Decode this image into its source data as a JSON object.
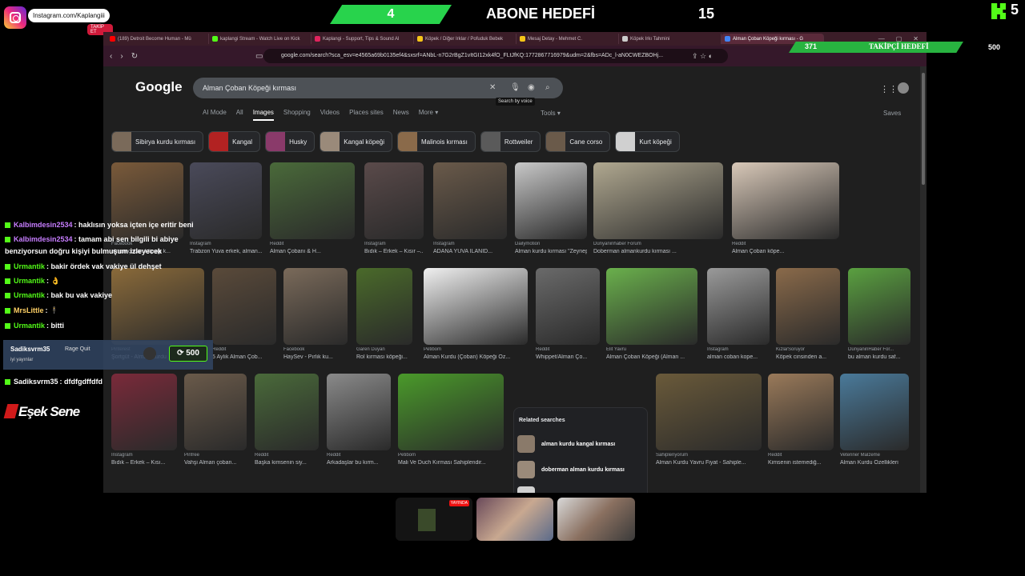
{
  "overlay": {
    "instagram_handle": "Instagram.com/Kaplangiii",
    "instagram_follow": "TAKİP ET",
    "sub_goal_current": "4",
    "sub_goal_title": "ABONE HEDEFİ",
    "sub_goal_target": "15",
    "kick_viewers": "5",
    "follower_current": "371",
    "follower_title": "TAKİPÇİ HEDEFİ",
    "follower_target": "500",
    "logo_text": "Eşek Sene",
    "live_badge": "YAYINDA"
  },
  "browser": {
    "tabs": [
      {
        "label": "(189) Detroit Become Human - Mü",
        "color": "#ff0000"
      },
      {
        "label": "kaplangi Stream - Watch Live on Kick",
        "color": "#53fc18"
      },
      {
        "label": "Kaplangi - Support, Tips & Sound Al",
        "color": "#e0245e"
      },
      {
        "label": "Köpek / Diğer Irklar / Pofuduk Bebek",
        "color": "#f5c518"
      },
      {
        "label": "Mesaj Detay - Mehmet C.",
        "color": "#f5c518"
      },
      {
        "label": "Köpek Irkı Tahmini",
        "color": "#cccccc"
      },
      {
        "label": "Alman Çoban Köpeği kırması - G",
        "color": "#4285f4"
      }
    ],
    "url": "google.com/search?sca_esv=e4565a69b0135ef4&sxsrf=ANbL-n7G2rBgZ1vItGI12xk4fO_FLtJfKQ:1772867716979&udm=2&fbs=ADc_l-aN0CWEZBOHj..."
  },
  "google": {
    "logo": "Google",
    "query": "Alman Çoban Köpeği kırması",
    "tooltip": "Search by voice",
    "tabs": [
      "AI Mode",
      "All",
      "Images",
      "Shopping",
      "Videos",
      "Places sites",
      "News",
      "More ▾"
    ],
    "tools": "Tools ▾",
    "saves": "Saves",
    "chips": [
      {
        "label": "Sibirya kurdu kırması",
        "color": "#7a6a5a"
      },
      {
        "label": "Kangal",
        "color": "#b22222"
      },
      {
        "label": "Husky",
        "color": "#8a3a6a"
      },
      {
        "label": "Kangal köpeği",
        "color": "#9a8a7a"
      },
      {
        "label": "Malinois kırması",
        "color": "#8a6a4a"
      },
      {
        "label": "Rottweiler",
        "color": "#5a5a5a"
      },
      {
        "label": "Cane corso",
        "color": "#6a5a4a"
      },
      {
        "label": "Kurt köpeği",
        "color": "#d0d0d0"
      }
    ],
    "images_row1": [
      {
        "src": "Facebook",
        "cap": "alman çoban köpeği k...",
        "color": "#7a5a3a"
      },
      {
        "src": "Instagram",
        "cap": "Trabzon Yuva erkek, alman...",
        "color": "#4a4a5a"
      },
      {
        "src": "Reddit",
        "cap": "Alman Çobanı & H...",
        "color": "#4a6a3a"
      },
      {
        "src": "Instagram",
        "cap": "Bıdık – Erkek – Kısır –...",
        "color": "#5a4a4a"
      },
      {
        "src": "Instagram",
        "cap": "ADANA YUVA İLANID...",
        "color": "#6a5a4a"
      },
      {
        "src": "Dailymotion",
        "cap": "Alman kurdu kırması \"Zeynep ...",
        "color": "#c8c8c8"
      },
      {
        "src": "Dünyaninhaber Forum",
        "cap": "Doberman almankurdu kırması ...",
        "color": "#b0a890"
      },
      {
        "src": "Reddit",
        "cap": "Alman Çoban köpe...",
        "color": "#d8c8b8"
      }
    ],
    "images_row2": [
      {
        "src": "Pinterest",
        "cap": "Şortgüt - Alman Kurdu",
        "color": "#8a6a3a"
      },
      {
        "src": "Reddit",
        "cap": "5 Aylık Alman Çob...",
        "color": "#5a4a3a"
      },
      {
        "src": "Facebook",
        "cap": "HaySev - Pırlık ku...",
        "color": "#7a6a5a"
      },
      {
        "src": "Garen Duyan",
        "cap": "Rol kırması köpeği...",
        "color": "#4a6a2a"
      },
      {
        "src": "Petibom",
        "cap": "Alman Kurdu (Çoban) Köpeği Öz...",
        "color": "#f0f0f0"
      },
      {
        "src": "Reddit",
        "cap": "Whippet/Alman Ço...",
        "color": "#6a6a6a"
      },
      {
        "src": "Elit Yavru",
        "cap": "Alman Çoban Köpeği (Alman ...",
        "color": "#6ab04c"
      },
      {
        "src": "Instagram",
        "cap": "alman coban kope...",
        "color": "#9a9a9a"
      },
      {
        "src": "KizlarSoruyor",
        "cap": "Köpek cinsinden a...",
        "color": "#8a6a4a"
      },
      {
        "src": "DünyaninHaber For...",
        "cap": "bu alman kurdu saf...",
        "color": "#5aa040"
      }
    ],
    "images_row3": [
      {
        "src": "Instagram",
        "cap": "Bıdık – Erkek – Kısı...",
        "color": "#7a2a3a"
      },
      {
        "src": "Pinfree",
        "cap": "Vahşi Alman çoban...",
        "color": "#6a5a4a"
      },
      {
        "src": "Reddit",
        "cap": "Başka kimsenin siy...",
        "color": "#4a6a3a"
      },
      {
        "src": "Reddit",
        "cap": "Arkadaşlar bu kırm...",
        "color": "#8a8a8a"
      },
      {
        "src": "Petibom",
        "cap": "Mali Ve Duch Kırması Sahiplendir...",
        "color": "#4a9a2a"
      },
      {
        "src": "Sahiplenyorum",
        "cap": "Alman Kurdu Yavru Fiyat - Sahiple...",
        "color": "#6a5a3a"
      },
      {
        "src": "Reddit",
        "cap": "Kimsenin istemediğ...",
        "color": "#9a7a5a"
      },
      {
        "src": "Veteriner Malzeme",
        "cap": "Alman Kurdu Özellikleri",
        "color": "#4a7a9a"
      }
    ],
    "related_title": "Related searches",
    "related": [
      {
        "label": "alman kurdu kangal kırması",
        "color": "#8a7a6a"
      },
      {
        "label": "doberman alman kurdu kırması",
        "color": "#9a8a7a"
      },
      {
        "label": "sibirya kurdu kurt köpeği",
        "color": "#d0d0d0"
      }
    ]
  },
  "chat": [
    {
      "user": "Kalbimdesin2534",
      "color": "#c77dff",
      "msg": ": haklısın yoksa içten içe eritir beni"
    },
    {
      "user": "Kalbimdesin2534",
      "color": "#c77dff",
      "msg": ": tamam abi sen bilgili bi abiye"
    },
    {
      "user": "",
      "color": "#ffffff",
      "msg": "benziyorsun doğru kişiyi bulmuşum izleyecek"
    },
    {
      "user": "Urmantik",
      "color": "#53fc18",
      "msg": ": bakir ördek vak vakiye ül dehşet"
    },
    {
      "user": "Urmantik",
      "color": "#53fc18",
      "msg": ": 👌"
    },
    {
      "user": "Urmantik",
      "color": "#53fc18",
      "msg": ": bak bu vak vakiye"
    },
    {
      "user": "MrsLittle",
      "color": "#ffd166",
      "msg": ": 🕴"
    },
    {
      "user": "Urmantik",
      "color": "#53fc18",
      "msg": ": bitti"
    },
    {
      "user": "Sadiksvrm35",
      "color": "#ffffff",
      "msg": ": dfdfgdffdfd"
    }
  ],
  "rage_quit": {
    "user": "Sadiksvrm35",
    "label": "Rage Quit",
    "note": "iyi yayınlar",
    "amount": "500"
  }
}
